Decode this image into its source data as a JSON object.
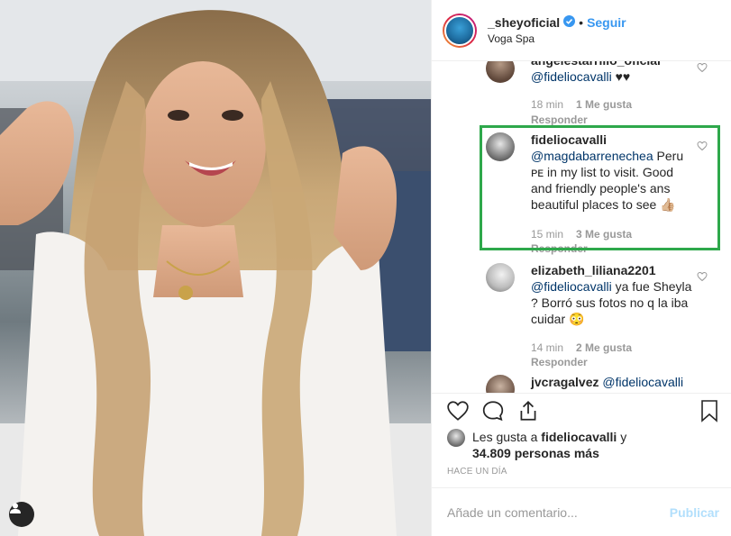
{
  "header": {
    "username": "_sheyoficial",
    "separator": "•",
    "follow_label": "Seguir",
    "location": "Voga Spa"
  },
  "comments": [
    {
      "user": "angelestarrillo_oficial",
      "mention": "@fideliocavalli",
      "text": " ♥♥",
      "time": "18 min",
      "likes": "1 Me gusta",
      "reply": "Responder"
    },
    {
      "user": "fideliocavalli",
      "mention": "@magdabarrenechea",
      "text": " Peru ᴘᴇ in my list to visit. Good and friendly people's ans beautiful places to see 👍🏼",
      "time": "15 min",
      "likes": "3 Me gusta",
      "reply": "Responder"
    },
    {
      "user": "elizabeth_liliana2201",
      "mention": "@fideliocavalli",
      "text": " ya fue Sheyla ? Borró sus fotos no q la iba cuidar 😳",
      "time": "14 min",
      "likes": "2 Me gusta",
      "reply": "Responder"
    },
    {
      "user": "jvcragalvez",
      "mention": "@fideliocavalli",
      "text": ""
    }
  ],
  "likes": {
    "prefix": "Les gusta a ",
    "user": "fideliocavalli",
    "middle": " y ",
    "count": "34.809 personas más"
  },
  "time_ago": "HACE UN DÍA",
  "add_comment": {
    "placeholder": "Añade un comentario...",
    "publish_label": "Publicar"
  },
  "icons": {
    "like": "heart-icon",
    "comment": "comment-icon",
    "share": "share-icon",
    "save": "bookmark-icon"
  },
  "colors": {
    "follow": "#3897f0",
    "highlight": "#2ea84b",
    "publish_disabled": "#b2dffc"
  }
}
